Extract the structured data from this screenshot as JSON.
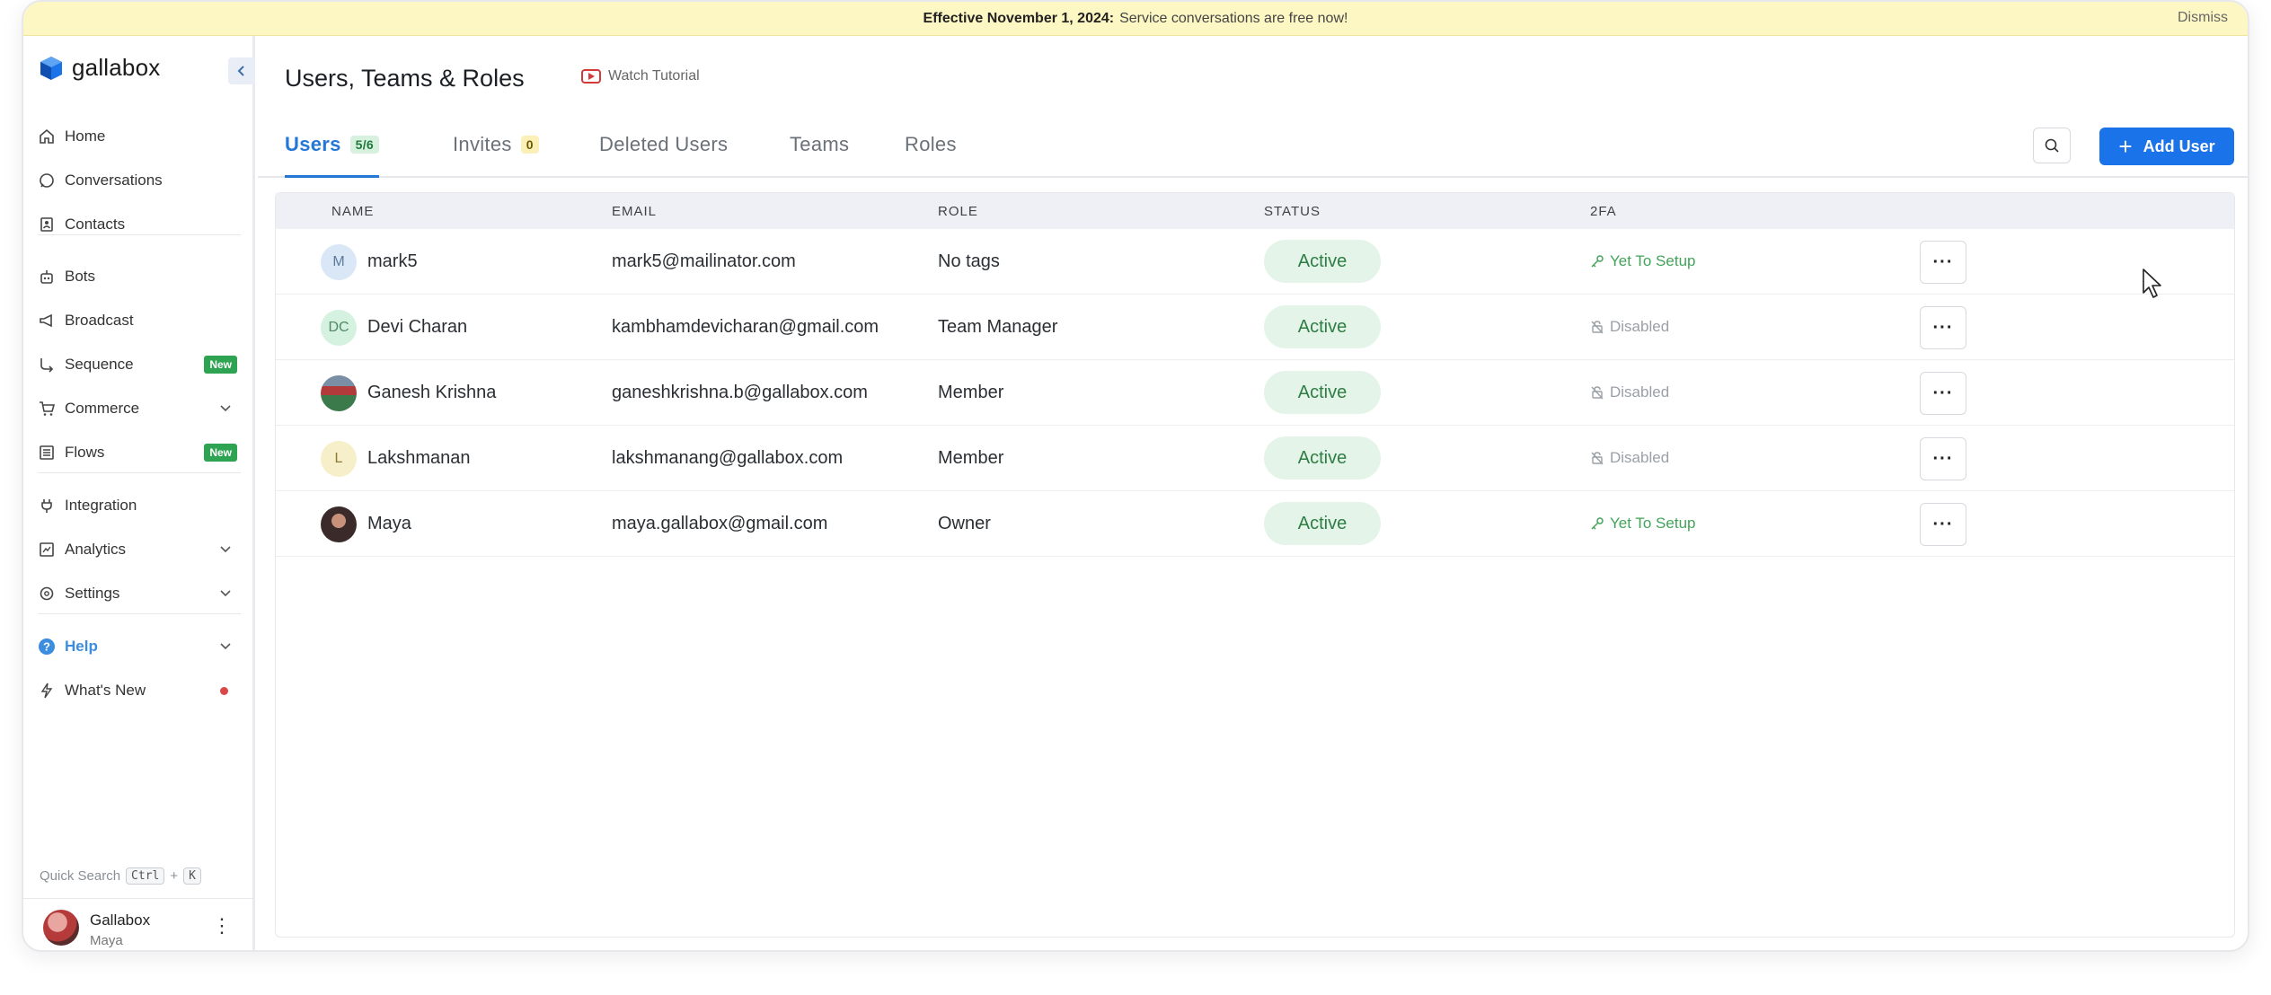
{
  "banner": {
    "bold": "Effective November 1, 2024:",
    "message": "Service conversations are free now!",
    "dismiss": "Dismiss"
  },
  "sidebar": {
    "brand": "gallabox",
    "items": [
      {
        "label": "Home",
        "icon": "home-icon"
      },
      {
        "label": "Conversations",
        "icon": "chat-icon"
      },
      {
        "label": "Contacts",
        "icon": "contacts-icon"
      },
      {
        "label": "Bots",
        "icon": "bot-icon"
      },
      {
        "label": "Broadcast",
        "icon": "megaphone-icon"
      },
      {
        "label": "Sequence",
        "icon": "sequence-icon",
        "badge": "New"
      },
      {
        "label": "Commerce",
        "icon": "cart-icon"
      },
      {
        "label": "Flows",
        "icon": "flows-icon",
        "badge": "New"
      },
      {
        "label": "Integration",
        "icon": "plug-icon"
      },
      {
        "label": "Analytics",
        "icon": "analytics-icon"
      },
      {
        "label": "Settings",
        "icon": "gear-icon"
      },
      {
        "label": "Help",
        "icon": "help-icon"
      },
      {
        "label": "What's New",
        "icon": "bolt-icon"
      }
    ],
    "quick_search": {
      "label": "Quick Search",
      "key1": "Ctrl",
      "plus": "+",
      "key2": "K"
    },
    "user": {
      "name": "Gallabox",
      "sub": "Maya"
    }
  },
  "header": {
    "title": "Users, Teams & Roles",
    "tutorial": "Watch Tutorial"
  },
  "tabs": [
    {
      "label": "Users",
      "badge": "5/6"
    },
    {
      "label": "Invites",
      "badge": "0"
    },
    {
      "label": "Deleted Users"
    },
    {
      "label": "Teams"
    },
    {
      "label": "Roles"
    }
  ],
  "actions": {
    "add_user": "Add User",
    "plus": "+"
  },
  "table": {
    "columns": [
      "NAME",
      "EMAIL",
      "ROLE",
      "STATUS",
      "2FA"
    ],
    "rows": [
      {
        "initials": "M",
        "name": "mark5",
        "email": "mark5@mailinator.com",
        "role": "No tags",
        "status": "Active",
        "tfa": "Yet To Setup"
      },
      {
        "initials": "DC",
        "name": "Devi Charan",
        "email": "kambhamdevicharan@gmail.com",
        "role": "Team Manager",
        "status": "Active",
        "tfa": "Disabled"
      },
      {
        "initials": "",
        "name": "Ganesh Krishna",
        "email": "ganeshkrishna.b@gallabox.com",
        "role": "Member",
        "status": "Active",
        "tfa": "Disabled"
      },
      {
        "initials": "L",
        "name": "Lakshmanan",
        "email": "lakshmanang@gallabox.com",
        "role": "Member",
        "status": "Active",
        "tfa": "Disabled"
      },
      {
        "initials": "",
        "name": "Maya",
        "email": "maya.gallabox@gmail.com",
        "role": "Owner",
        "status": "Active",
        "tfa": "Yet To Setup"
      }
    ],
    "more": "···"
  }
}
